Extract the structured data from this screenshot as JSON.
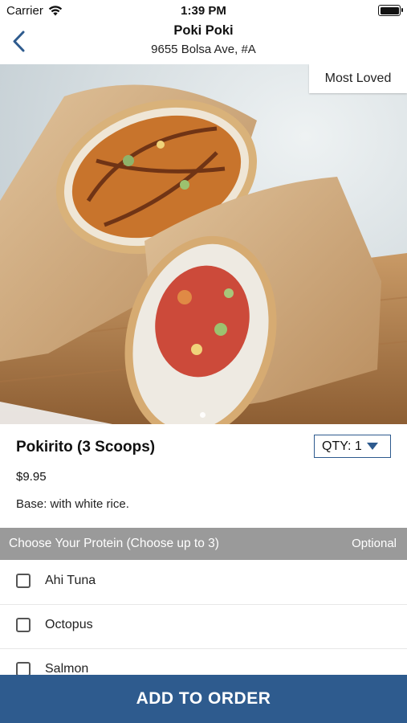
{
  "status_bar": {
    "carrier": "Carrier",
    "time": "1:39 PM"
  },
  "navbar": {
    "title": "Poki Poki",
    "subtitle": "9655 Bolsa Ave, #A"
  },
  "hero": {
    "badge": "Most Loved"
  },
  "item": {
    "name": "Pokirito (3 Scoops)",
    "price": "$9.95",
    "base": "Base: with white rice.",
    "qty_label": "QTY: 1"
  },
  "section": {
    "title": "Choose Your Protein (Choose up to 3)",
    "optional": "Optional"
  },
  "options": [
    {
      "label": "Ahi Tuna",
      "checked": false
    },
    {
      "label": "Octopus",
      "checked": false
    },
    {
      "label": "Salmon",
      "checked": false
    }
  ],
  "cta": {
    "label": "ADD TO ORDER"
  },
  "colors": {
    "primary": "#2e5b8e",
    "section_bg": "#9a9a9a",
    "accent_border": "#2d5a8e"
  }
}
